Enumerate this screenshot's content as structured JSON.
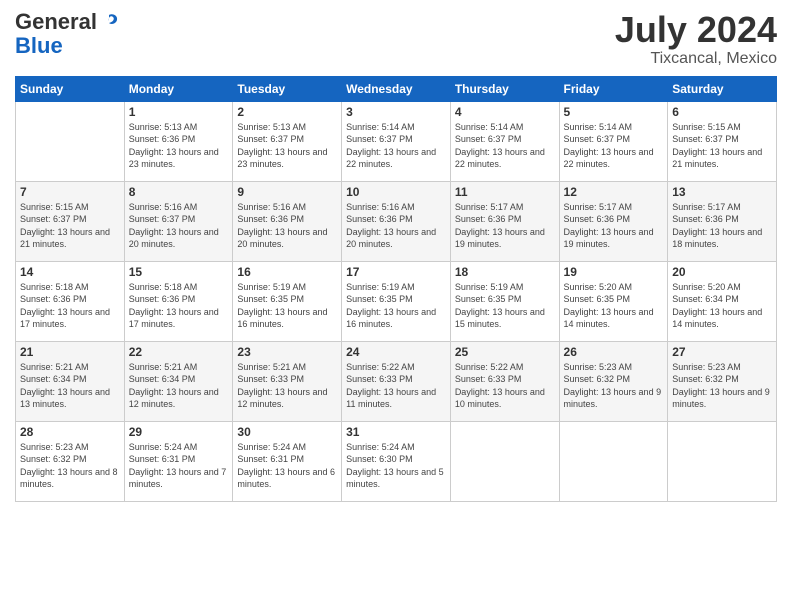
{
  "header": {
    "logo_general": "General",
    "logo_blue": "Blue",
    "month_title": "July 2024",
    "location": "Tixcancal, Mexico"
  },
  "days_of_week": [
    "Sunday",
    "Monday",
    "Tuesday",
    "Wednesday",
    "Thursday",
    "Friday",
    "Saturday"
  ],
  "weeks": [
    [
      {
        "day": "",
        "sunrise": "",
        "sunset": "",
        "daylight": ""
      },
      {
        "day": "1",
        "sunrise": "Sunrise: 5:13 AM",
        "sunset": "Sunset: 6:36 PM",
        "daylight": "Daylight: 13 hours and 23 minutes."
      },
      {
        "day": "2",
        "sunrise": "Sunrise: 5:13 AM",
        "sunset": "Sunset: 6:37 PM",
        "daylight": "Daylight: 13 hours and 23 minutes."
      },
      {
        "day": "3",
        "sunrise": "Sunrise: 5:14 AM",
        "sunset": "Sunset: 6:37 PM",
        "daylight": "Daylight: 13 hours and 22 minutes."
      },
      {
        "day": "4",
        "sunrise": "Sunrise: 5:14 AM",
        "sunset": "Sunset: 6:37 PM",
        "daylight": "Daylight: 13 hours and 22 minutes."
      },
      {
        "day": "5",
        "sunrise": "Sunrise: 5:14 AM",
        "sunset": "Sunset: 6:37 PM",
        "daylight": "Daylight: 13 hours and 22 minutes."
      },
      {
        "day": "6",
        "sunrise": "Sunrise: 5:15 AM",
        "sunset": "Sunset: 6:37 PM",
        "daylight": "Daylight: 13 hours and 21 minutes."
      }
    ],
    [
      {
        "day": "7",
        "sunrise": "Sunrise: 5:15 AM",
        "sunset": "Sunset: 6:37 PM",
        "daylight": "Daylight: 13 hours and 21 minutes."
      },
      {
        "day": "8",
        "sunrise": "Sunrise: 5:16 AM",
        "sunset": "Sunset: 6:37 PM",
        "daylight": "Daylight: 13 hours and 20 minutes."
      },
      {
        "day": "9",
        "sunrise": "Sunrise: 5:16 AM",
        "sunset": "Sunset: 6:36 PM",
        "daylight": "Daylight: 13 hours and 20 minutes."
      },
      {
        "day": "10",
        "sunrise": "Sunrise: 5:16 AM",
        "sunset": "Sunset: 6:36 PM",
        "daylight": "Daylight: 13 hours and 20 minutes."
      },
      {
        "day": "11",
        "sunrise": "Sunrise: 5:17 AM",
        "sunset": "Sunset: 6:36 PM",
        "daylight": "Daylight: 13 hours and 19 minutes."
      },
      {
        "day": "12",
        "sunrise": "Sunrise: 5:17 AM",
        "sunset": "Sunset: 6:36 PM",
        "daylight": "Daylight: 13 hours and 19 minutes."
      },
      {
        "day": "13",
        "sunrise": "Sunrise: 5:17 AM",
        "sunset": "Sunset: 6:36 PM",
        "daylight": "Daylight: 13 hours and 18 minutes."
      }
    ],
    [
      {
        "day": "14",
        "sunrise": "Sunrise: 5:18 AM",
        "sunset": "Sunset: 6:36 PM",
        "daylight": "Daylight: 13 hours and 17 minutes."
      },
      {
        "day": "15",
        "sunrise": "Sunrise: 5:18 AM",
        "sunset": "Sunset: 6:36 PM",
        "daylight": "Daylight: 13 hours and 17 minutes."
      },
      {
        "day": "16",
        "sunrise": "Sunrise: 5:19 AM",
        "sunset": "Sunset: 6:35 PM",
        "daylight": "Daylight: 13 hours and 16 minutes."
      },
      {
        "day": "17",
        "sunrise": "Sunrise: 5:19 AM",
        "sunset": "Sunset: 6:35 PM",
        "daylight": "Daylight: 13 hours and 16 minutes."
      },
      {
        "day": "18",
        "sunrise": "Sunrise: 5:19 AM",
        "sunset": "Sunset: 6:35 PM",
        "daylight": "Daylight: 13 hours and 15 minutes."
      },
      {
        "day": "19",
        "sunrise": "Sunrise: 5:20 AM",
        "sunset": "Sunset: 6:35 PM",
        "daylight": "Daylight: 13 hours and 14 minutes."
      },
      {
        "day": "20",
        "sunrise": "Sunrise: 5:20 AM",
        "sunset": "Sunset: 6:34 PM",
        "daylight": "Daylight: 13 hours and 14 minutes."
      }
    ],
    [
      {
        "day": "21",
        "sunrise": "Sunrise: 5:21 AM",
        "sunset": "Sunset: 6:34 PM",
        "daylight": "Daylight: 13 hours and 13 minutes."
      },
      {
        "day": "22",
        "sunrise": "Sunrise: 5:21 AM",
        "sunset": "Sunset: 6:34 PM",
        "daylight": "Daylight: 13 hours and 12 minutes."
      },
      {
        "day": "23",
        "sunrise": "Sunrise: 5:21 AM",
        "sunset": "Sunset: 6:33 PM",
        "daylight": "Daylight: 13 hours and 12 minutes."
      },
      {
        "day": "24",
        "sunrise": "Sunrise: 5:22 AM",
        "sunset": "Sunset: 6:33 PM",
        "daylight": "Daylight: 13 hours and 11 minutes."
      },
      {
        "day": "25",
        "sunrise": "Sunrise: 5:22 AM",
        "sunset": "Sunset: 6:33 PM",
        "daylight": "Daylight: 13 hours and 10 minutes."
      },
      {
        "day": "26",
        "sunrise": "Sunrise: 5:23 AM",
        "sunset": "Sunset: 6:32 PM",
        "daylight": "Daylight: 13 hours and 9 minutes."
      },
      {
        "day": "27",
        "sunrise": "Sunrise: 5:23 AM",
        "sunset": "Sunset: 6:32 PM",
        "daylight": "Daylight: 13 hours and 9 minutes."
      }
    ],
    [
      {
        "day": "28",
        "sunrise": "Sunrise: 5:23 AM",
        "sunset": "Sunset: 6:32 PM",
        "daylight": "Daylight: 13 hours and 8 minutes."
      },
      {
        "day": "29",
        "sunrise": "Sunrise: 5:24 AM",
        "sunset": "Sunset: 6:31 PM",
        "daylight": "Daylight: 13 hours and 7 minutes."
      },
      {
        "day": "30",
        "sunrise": "Sunrise: 5:24 AM",
        "sunset": "Sunset: 6:31 PM",
        "daylight": "Daylight: 13 hours and 6 minutes."
      },
      {
        "day": "31",
        "sunrise": "Sunrise: 5:24 AM",
        "sunset": "Sunset: 6:30 PM",
        "daylight": "Daylight: 13 hours and 5 minutes."
      },
      {
        "day": "",
        "sunrise": "",
        "sunset": "",
        "daylight": ""
      },
      {
        "day": "",
        "sunrise": "",
        "sunset": "",
        "daylight": ""
      },
      {
        "day": "",
        "sunrise": "",
        "sunset": "",
        "daylight": ""
      }
    ]
  ]
}
